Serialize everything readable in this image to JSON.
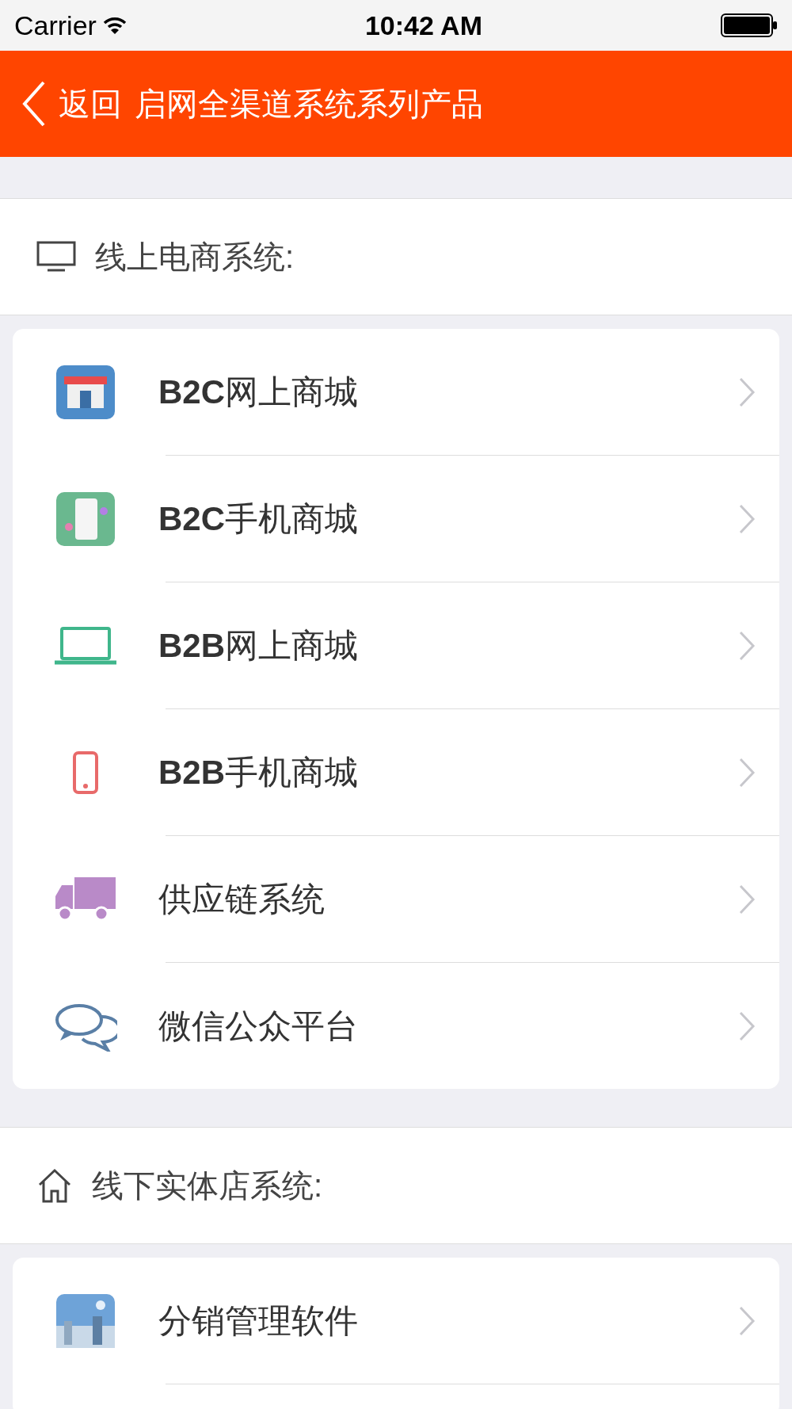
{
  "status_bar": {
    "carrier": "Carrier",
    "time": "10:42 AM"
  },
  "nav_bar": {
    "back_label": "返回",
    "title": "启网全渠道系统系列产品"
  },
  "sections": [
    {
      "header": "线上电商系统:",
      "items": [
        {
          "label": "**B2C**网上商城"
        },
        {
          "label": "**B2C**手机商城"
        },
        {
          "label": "**B2B**网上商城"
        },
        {
          "label": "**B2B**手机商城"
        },
        {
          "label": "供应链系统"
        },
        {
          "label": "微信公众平台"
        }
      ]
    },
    {
      "header": "线下实体店系统:",
      "items": [
        {
          "label": "分销管理软件"
        }
      ]
    }
  ]
}
